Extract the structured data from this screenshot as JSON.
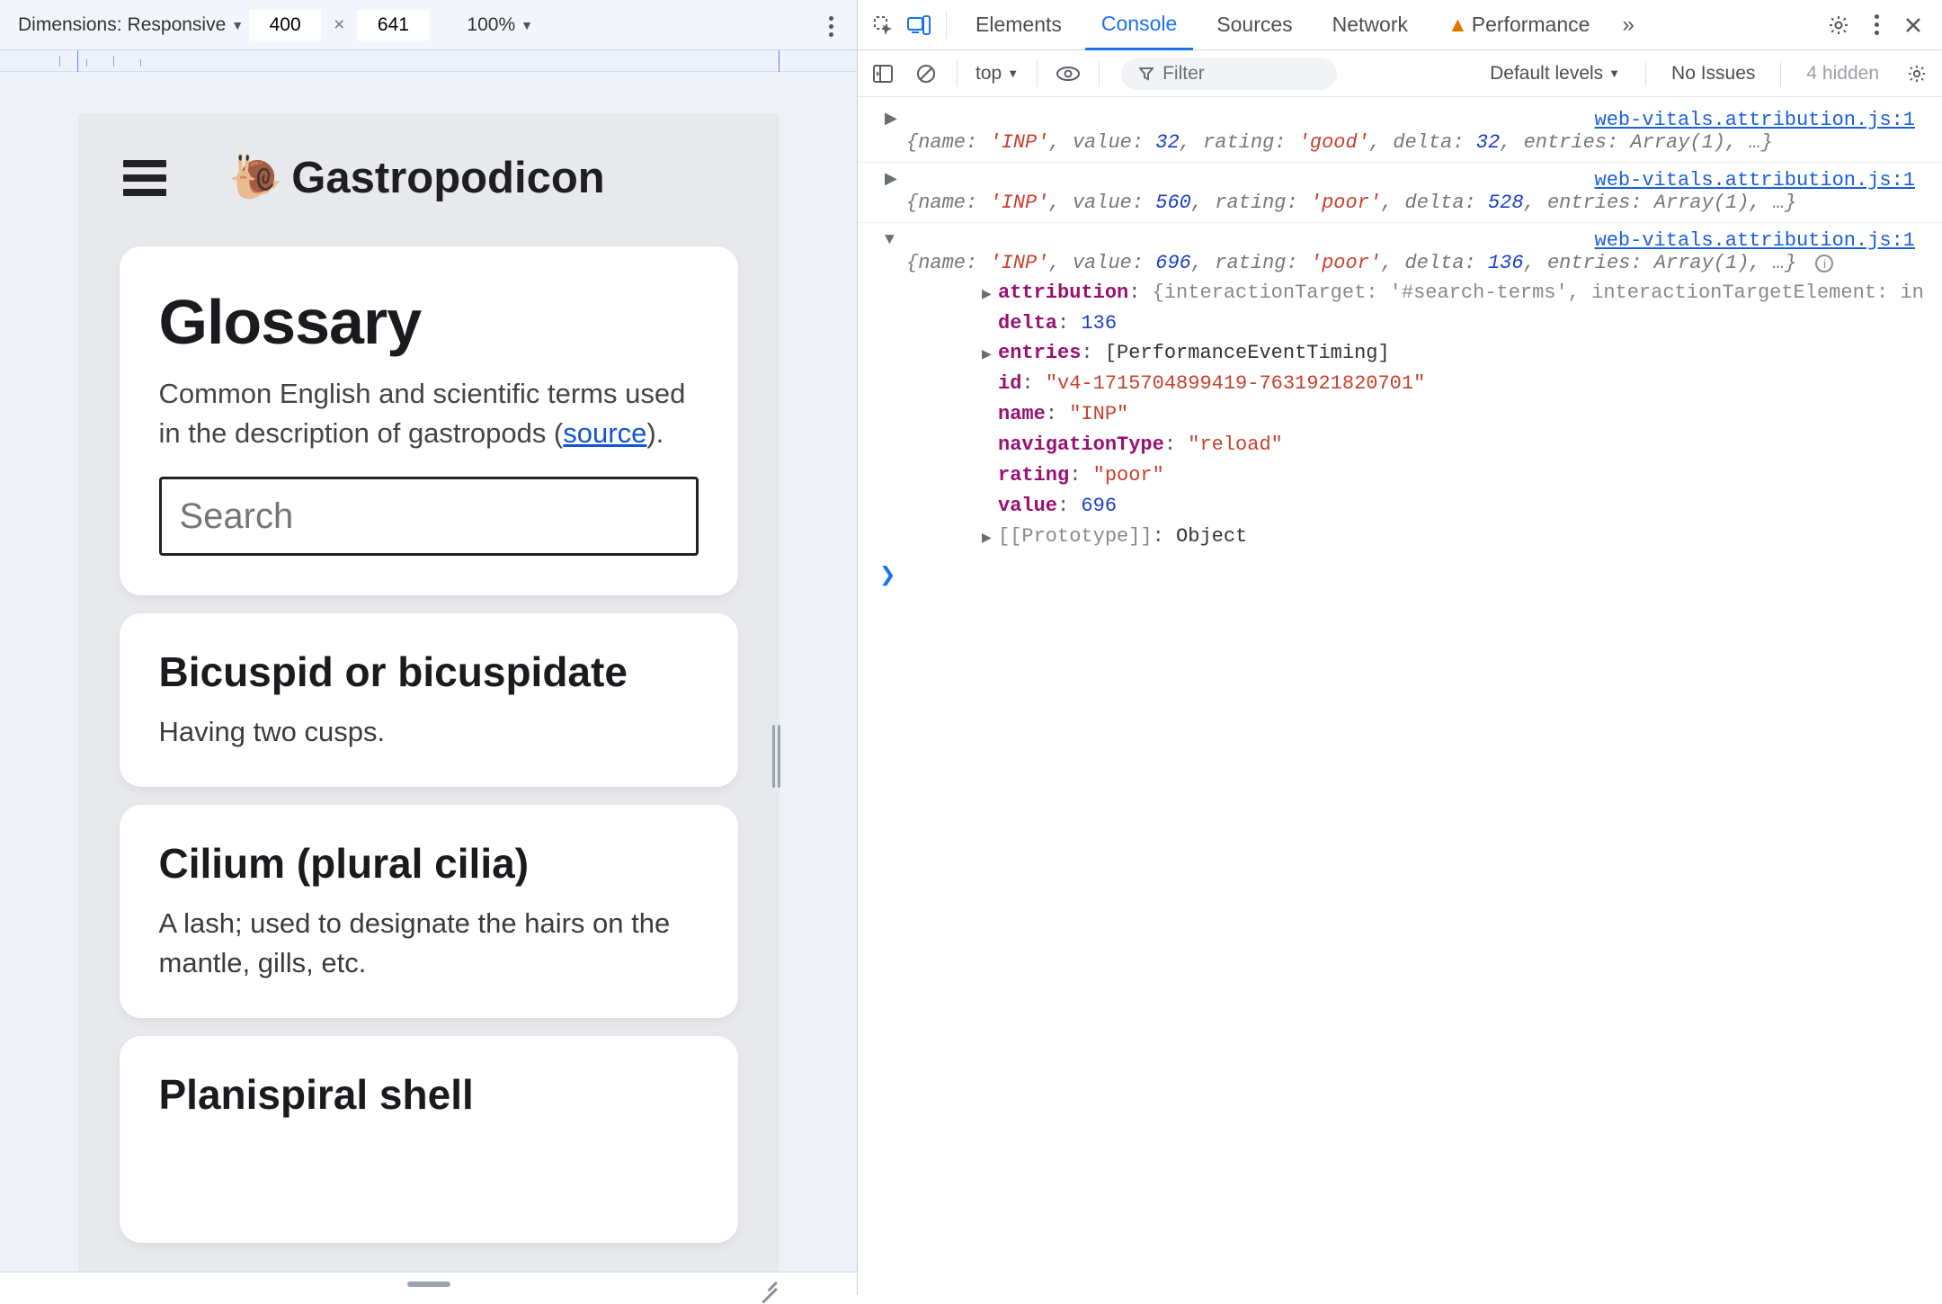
{
  "deviceBar": {
    "dimensionsLabel": "Dimensions:",
    "deviceName": "Responsive",
    "width": "400",
    "height": "641",
    "zoom": "100%"
  },
  "site": {
    "title": "Gastropodicon",
    "snail": "🐌"
  },
  "glossary": {
    "heading": "Glossary",
    "descPrefix": "Common English and scientific terms used in the description of gastropods (",
    "sourceLabel": "source",
    "descSuffix": ").",
    "searchPlaceholder": "Search"
  },
  "entries": [
    {
      "title": "Bicuspid or bicuspidate",
      "body": "Having two cusps."
    },
    {
      "title": "Cilium (plural cilia)",
      "body": "A lash; used to designate the hairs on the mantle, gills, etc."
    },
    {
      "title": "Planispiral shell",
      "body": ""
    }
  ],
  "devtools": {
    "tabs": {
      "elements": "Elements",
      "console": "Console",
      "sources": "Sources",
      "network": "Network",
      "performance": "Performance"
    },
    "toolbar": {
      "context": "top",
      "filterPlaceholder": "Filter",
      "levels": "Default levels",
      "issues": "No Issues",
      "hidden": "4 hidden"
    },
    "sourceLink": "web-vitals.attribution.js:1",
    "logs": [
      {
        "summary": "{name: 'INP', value: 32, rating: 'good', delta: 32, entries: Array(1), …}",
        "expanded": false
      },
      {
        "summary": "{name: 'INP', value: 560, rating: 'poor', delta: 528, entries: Array(1), …}",
        "expanded": false
      },
      {
        "summary": "{name: 'INP', value: 696, rating: 'poor', delta: 136, entries: Array(1), …}",
        "expanded": true,
        "props": {
          "attributionSummary": "{interactionTarget: '#search-terms', interactionTargetElement: in",
          "delta": "136",
          "entriesSummary": "[PerformanceEventTiming]",
          "id": "\"v4-1715704899419-7631921820701\"",
          "name": "\"INP\"",
          "navigationType": "\"reload\"",
          "rating": "\"poor\"",
          "value": "696",
          "protoLabel": "[[Prototype]]",
          "protoValue": "Object"
        }
      }
    ]
  }
}
